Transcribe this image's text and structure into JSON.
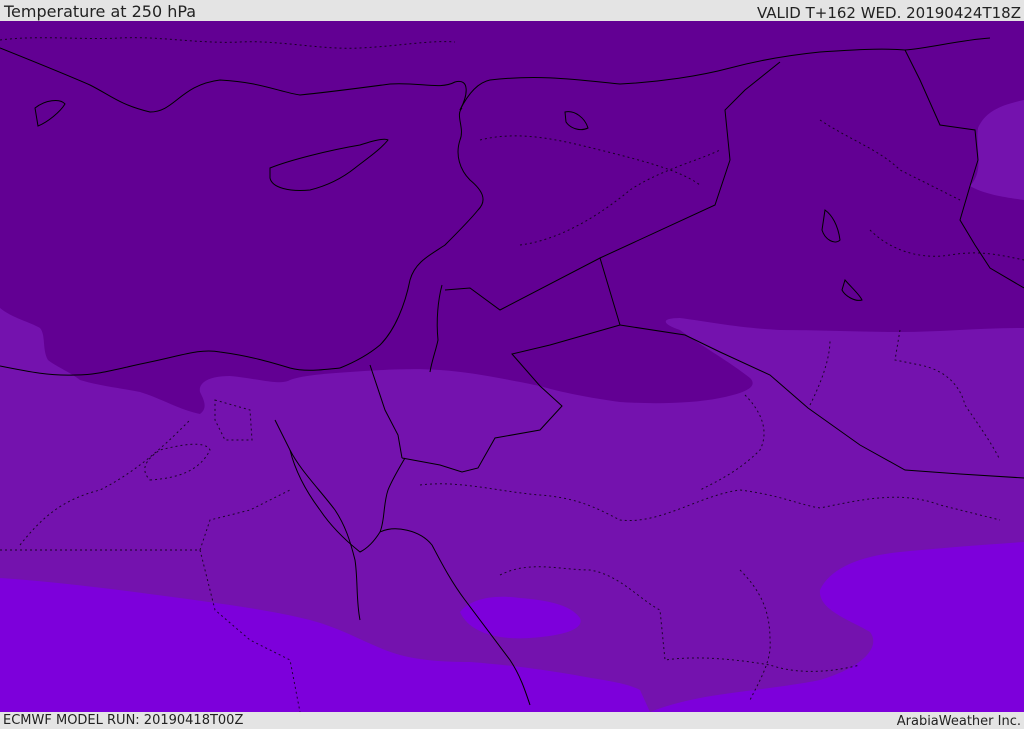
{
  "header": {
    "title": "Temperature at 250 hPa",
    "valid": "VALID T+162 WED. 20190424T18Z"
  },
  "footer": {
    "model_run": "ECMWF MODEL RUN: 20190418T00Z",
    "credit": "ArabiaWeather Inc."
  },
  "map": {
    "field": "temperature",
    "level": "250 hPa",
    "colors": {
      "coldest": "#620093",
      "cold": "#7412ae",
      "mild": "#7d00db",
      "coast": "#000000",
      "border": "#000000"
    }
  }
}
